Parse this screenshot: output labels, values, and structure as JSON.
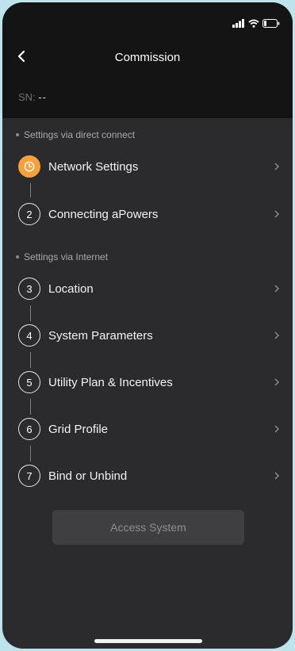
{
  "header": {
    "title": "Commission",
    "sn_label": "SN:",
    "sn_value": "--"
  },
  "sections": [
    {
      "title": "Settings via direct connect"
    },
    {
      "title": "Settings via Internet"
    }
  ],
  "steps": [
    {
      "number": "",
      "label": "Network Settings",
      "icon": "clock-icon",
      "active": true
    },
    {
      "number": "2",
      "label": "Connecting aPowers"
    },
    {
      "number": "3",
      "label": "Location"
    },
    {
      "number": "4",
      "label": "System Parameters"
    },
    {
      "number": "5",
      "label": "Utility Plan & Incentives"
    },
    {
      "number": "6",
      "label": "Grid Profile"
    },
    {
      "number": "7",
      "label": "Bind or Unbind"
    }
  ],
  "action": {
    "label": "Access System"
  },
  "colors": {
    "accent": "#f5a13c",
    "background": "#2b2b2d",
    "header_bg": "#141414"
  }
}
